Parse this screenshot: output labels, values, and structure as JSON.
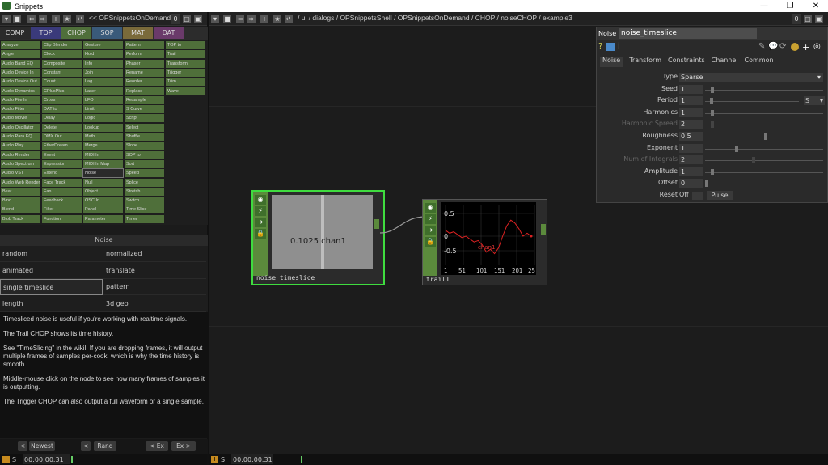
{
  "window": {
    "title": "Snippets",
    "minimize": "—",
    "maximize": "❐",
    "close": "✕"
  },
  "left_toolbar": {
    "path": "<< OPSnippetsOnDemand",
    "num": "0"
  },
  "right_toolbar": {
    "path": "/ ui / dialogs / OPSnippetsShell / OPSnippetsOnDemand / CHOP / noiseCHOP / example3",
    "num": "0"
  },
  "family_tabs": [
    {
      "label": "COMP",
      "color": "#2a2a2a"
    },
    {
      "label": "TOP",
      "color": "#3a3a7a"
    },
    {
      "label": "CHOP",
      "color": "#4f6f3a"
    },
    {
      "label": "SOP",
      "color": "#3a5a7a"
    },
    {
      "label": "MAT",
      "color": "#7a6a3a"
    },
    {
      "label": "DAT",
      "color": "#6a3a6a"
    }
  ],
  "operator_columns": [
    [
      "Analyze",
      "Angle",
      "Audio Band EQ",
      "Audio Device In",
      "Audio Device Out",
      "Audio Dynamics",
      "Audio File In",
      "Audio Filter",
      "Audio Movie",
      "Audio Oscillator",
      "Audio Para EQ",
      "Audio Play",
      "Audio Render",
      "Audio Spectrum",
      "Audio VST",
      "Audio Web Render",
      "Beat",
      "Bind",
      "Blend",
      "Blob Track"
    ],
    [
      "Clip Blender",
      "Clock",
      "Composite",
      "Constant",
      "Count",
      "CPlusPlus",
      "Cross",
      "DAT to",
      "Delay",
      "Delete",
      "DMX Out",
      "EtherDream",
      "Event",
      "Expression",
      "Extend",
      "Face Track",
      "Fan",
      "Feedback",
      "Filter",
      "Function"
    ],
    [
      "Gesture",
      "Hold",
      "Info",
      "Join",
      "Lag",
      "Laser",
      "LFO",
      "Limit",
      "Logic",
      "Lookup",
      "Math",
      "Merge",
      "MIDI In",
      "MIDI In Map",
      "Noise",
      "Null",
      "Object",
      "OSC In",
      "Panel",
      "Parameter"
    ],
    [
      "Pattern",
      "Perform",
      "Phaser",
      "Rename",
      "Reorder",
      "Replace",
      "Resample",
      "S Curve",
      "Script",
      "Select",
      "Shuffle",
      "Slope",
      "SOP to",
      "Sort",
      "Speed",
      "Splice",
      "Stretch",
      "Switch",
      "Time Slice",
      "Timer"
    ],
    [
      "TOP to",
      "Trail",
      "Transform",
      "Trigger",
      "Trim",
      "Wave"
    ]
  ],
  "lower_panel": {
    "heading": "Noise",
    "tags": [
      [
        "random",
        "normalized"
      ],
      [
        "animated",
        "translate"
      ],
      [
        "single timeslice",
        "pattern"
      ],
      [
        "length",
        "3d geo"
      ]
    ],
    "description": [
      "Timesliced noise is useful if you're working with realtime signals.",
      "The Trail CHOP shows its time history.",
      "See \"TimeSlicing\" in the wikil. If you are dropping frames, it will output multiple frames of samples per-cook, which is why the time history is smooth.",
      "Middle-mouse click on the node to see how many frames of samples it is outputting.",
      "The Trigger CHOP can also output a full waveform or a single sample."
    ],
    "nav": {
      "prev": "<",
      "newest": "Newest",
      "prev2": "<",
      "rand": "Rand",
      "ex_prev": "< Ex",
      "ex_next": "Ex >"
    }
  },
  "status": {
    "left_time": "00:00:00.31",
    "right_time": "00:00:00.31",
    "s": "S",
    "i": "I"
  },
  "nodes": {
    "noise": {
      "name": "noise_timeslice",
      "value": "0.1025 chan1"
    },
    "trail": {
      "name": "trail1",
      "y_ticks": [
        "0.5",
        "0",
        "-0.5"
      ],
      "x_ticks": [
        "1",
        "51",
        "101",
        "151",
        "201",
        "25"
      ],
      "channel": "chan1"
    }
  },
  "params": {
    "family": "Noise",
    "node_name": "noise_timeslice",
    "tabs": [
      "Noise",
      "Transform",
      "Constraints",
      "Channel",
      "Common"
    ],
    "rows": [
      {
        "label": "Type",
        "value": "Sparse",
        "kind": "menu"
      },
      {
        "label": "Seed",
        "value": "1",
        "kind": "slider",
        "pos": 0.05
      },
      {
        "label": "Period",
        "value": "1",
        "kind": "slider",
        "pos": 0.05,
        "unit": "S"
      },
      {
        "label": "Harmonics",
        "value": "1",
        "kind": "slider",
        "pos": 0.05
      },
      {
        "label": "Harmonic Spread",
        "value": "2",
        "kind": "slider",
        "pos": 0.05,
        "dim": true
      },
      {
        "label": "Roughness",
        "value": "0.5",
        "kind": "slider",
        "pos": 0.5
      },
      {
        "label": "Exponent",
        "value": "1",
        "kind": "slider",
        "pos": 0.25
      },
      {
        "label": "Num of Integrals",
        "value": "2",
        "kind": "slider",
        "pos": 0.4,
        "dim": true
      },
      {
        "label": "Amplitude",
        "value": "1",
        "kind": "slider",
        "pos": 0.05
      },
      {
        "label": "Offset",
        "value": "0",
        "kind": "slider",
        "pos": 0.0
      },
      {
        "label": "Reset",
        "value": "Off",
        "kind": "pulse",
        "pulse": "Pulse"
      }
    ],
    "header_icons": [
      "?",
      "i"
    ]
  },
  "trail_series": [
    0.2,
    0.1,
    0.15,
    0.05,
    -0.05,
    0.0,
    -0.1,
    -0.2,
    -0.15,
    -0.3,
    -0.55,
    -0.45,
    -0.6,
    -0.4,
    0.0,
    0.35,
    0.55,
    0.45,
    0.25,
    0.0,
    0.1,
    0.0
  ]
}
